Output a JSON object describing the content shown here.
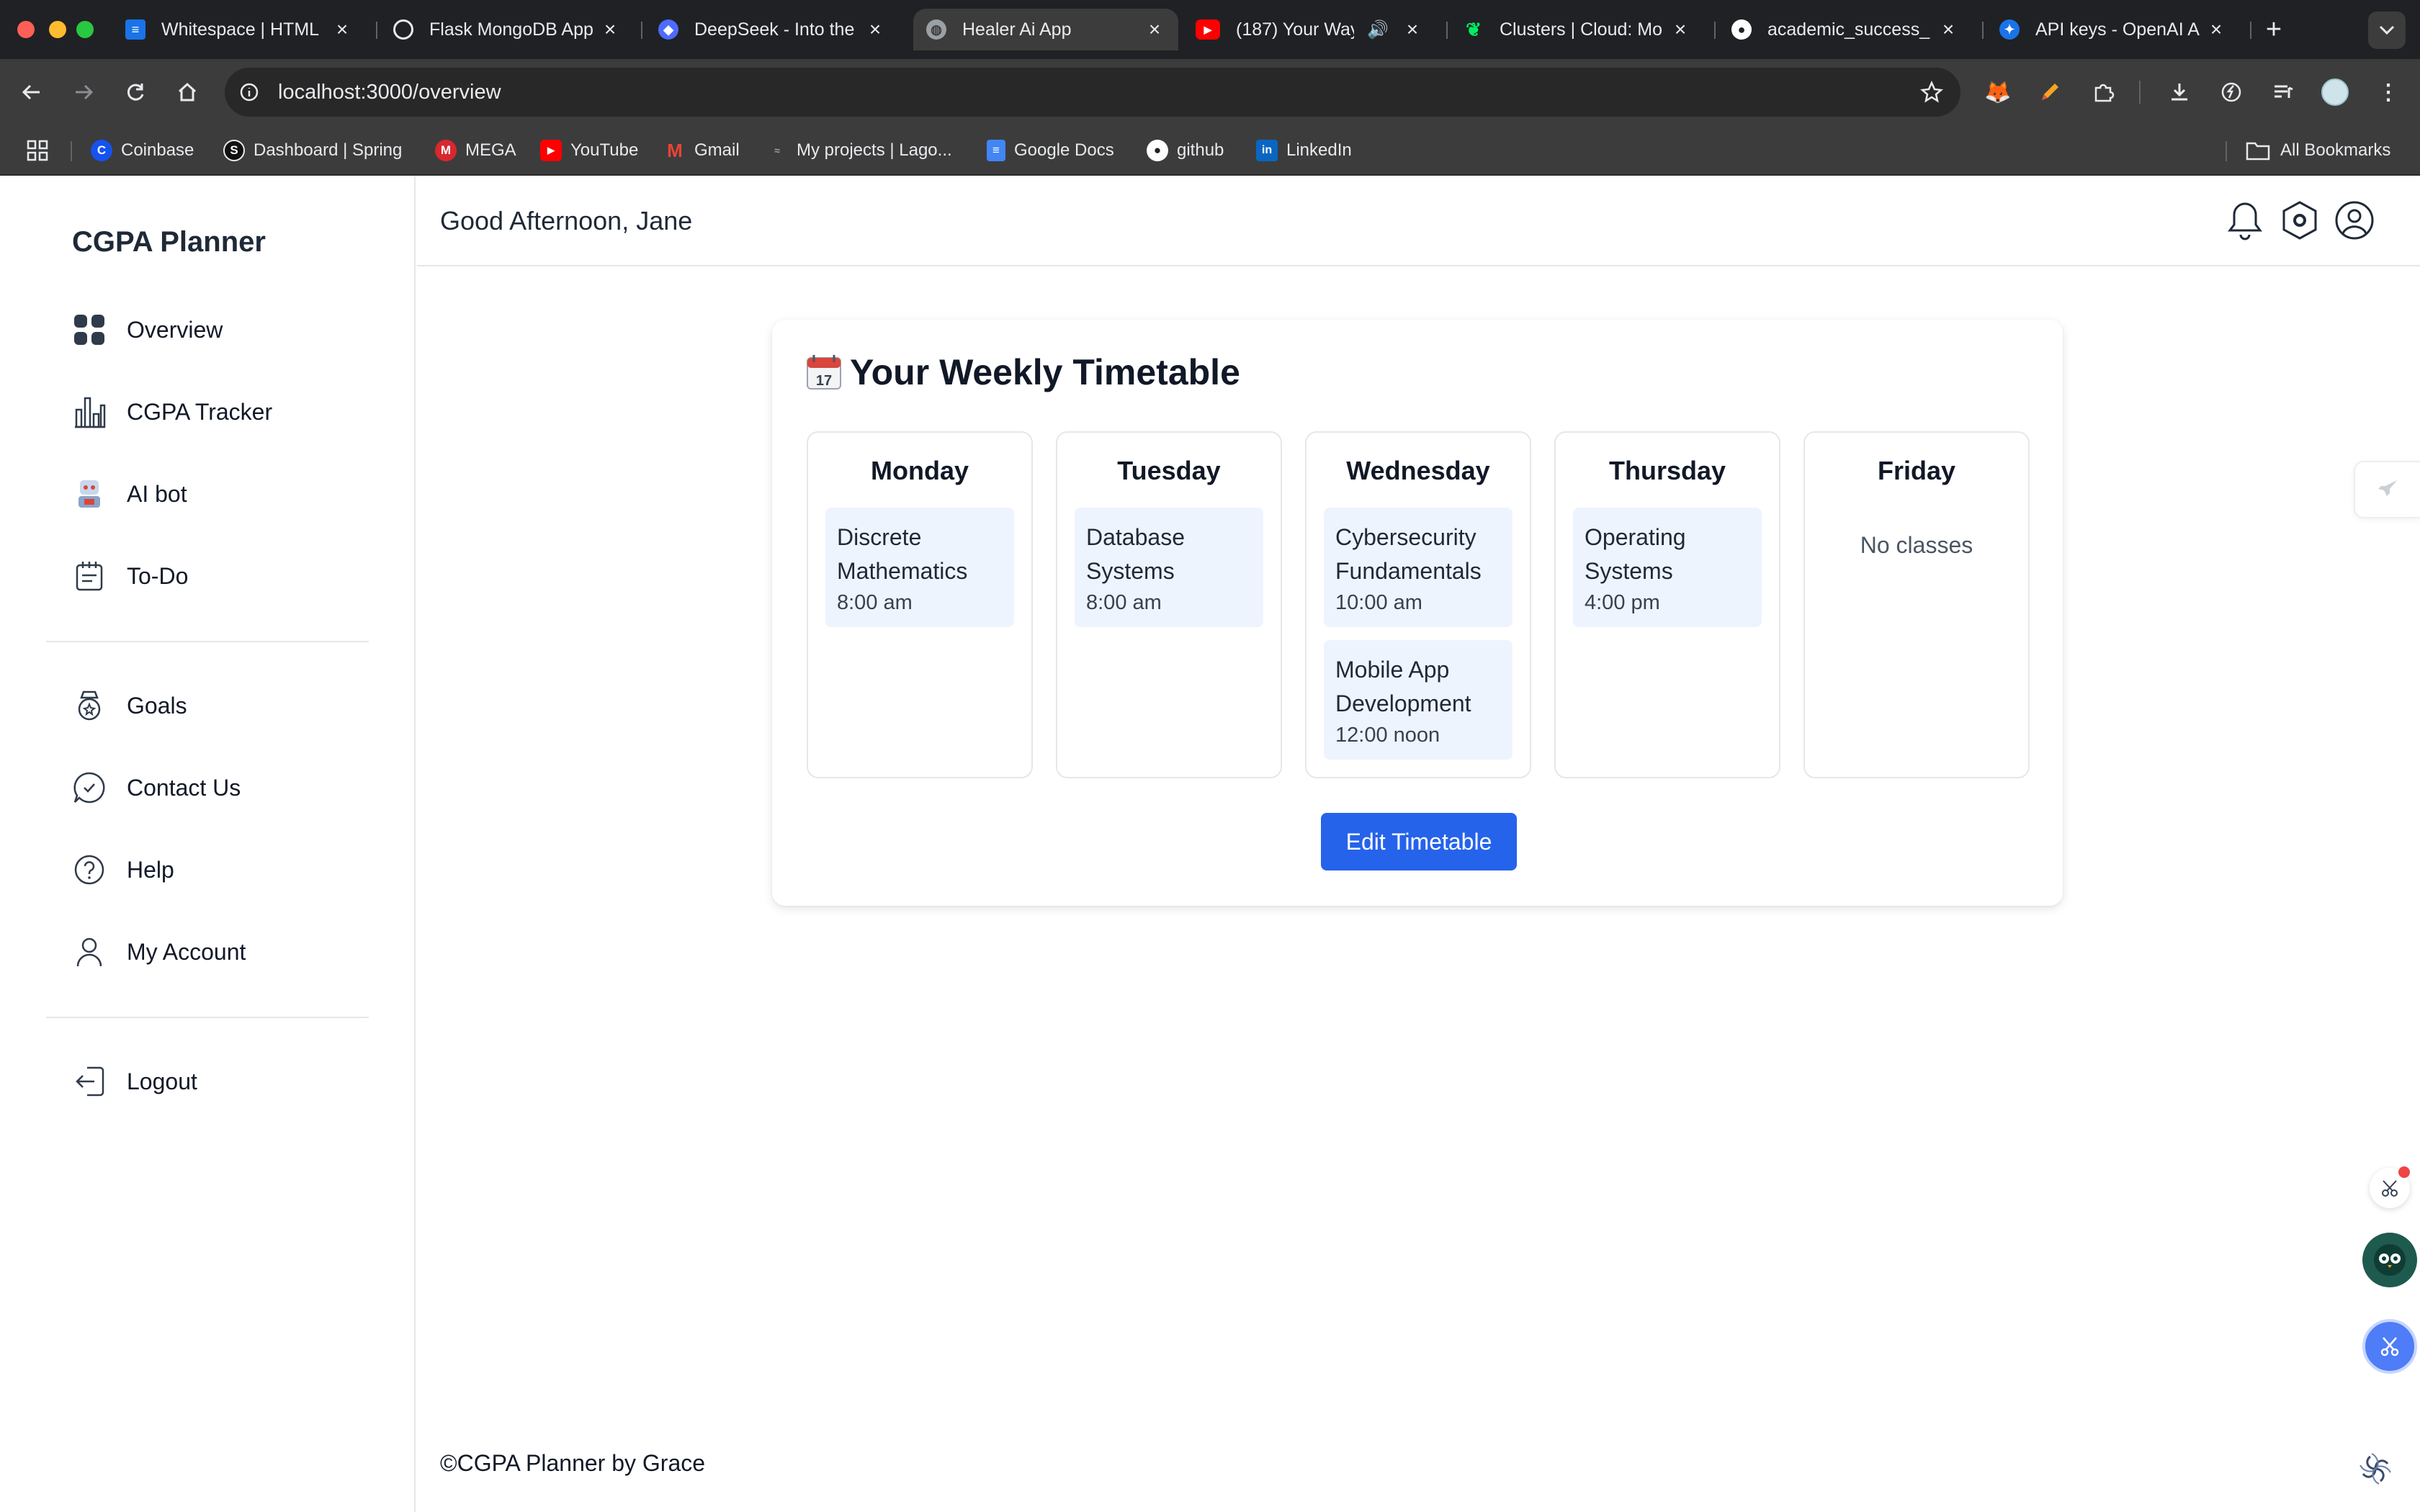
{
  "browser": {
    "tabs": [
      {
        "title": "Whitespace | HTML",
        "icon": "document-icon",
        "color": "#1a73e8"
      },
      {
        "title": "Flask MongoDB App",
        "icon": "openai-icon",
        "color": "#e8eaed"
      },
      {
        "title": "DeepSeek - Into the",
        "icon": "deepseek-icon",
        "color": "#4d6bfe"
      },
      {
        "title": "Healer Ai App",
        "icon": "globe-icon",
        "color": "#9aa0a6"
      },
      {
        "title": "(187) Your Way",
        "icon": "youtube-icon",
        "color": "#ff0000"
      },
      {
        "title": "Clusters | Cloud: Mo",
        "icon": "mongodb-leaf-icon",
        "color": "#00ed64"
      },
      {
        "title": "academic_success_",
        "icon": "github-icon",
        "color": "#ffffff"
      },
      {
        "title": "API keys - OpenAI A",
        "icon": "openai-icon",
        "color": "#1a73e8"
      }
    ],
    "active_tab_index": 3,
    "url": "localhost:3000/overview",
    "bookmarks": [
      {
        "label": "Coinbase",
        "icon": "coinbase-icon",
        "color": "#1652f0"
      },
      {
        "label": "Dashboard | Spring",
        "icon": "spring-icon",
        "color": "#111111"
      },
      {
        "label": "MEGA",
        "icon": "mega-icon",
        "color": "#d9272e"
      },
      {
        "label": "YouTube",
        "icon": "youtube-icon",
        "color": "#ff0000"
      },
      {
        "label": "Gmail",
        "icon": "gmail-icon",
        "color": "#ea4335"
      },
      {
        "label": "My projects | Lago...",
        "icon": "lago-icon",
        "color": "#5f6368"
      },
      {
        "label": "Google Docs",
        "icon": "google-docs-icon",
        "color": "#4285f4"
      },
      {
        "label": "github",
        "icon": "github-icon",
        "color": "#ffffff"
      },
      {
        "label": "LinkedIn",
        "icon": "linkedin-icon",
        "color": "#0a66c2"
      }
    ],
    "all_bookmarks_label": "All Bookmarks"
  },
  "sidebar": {
    "brand": "CGPA Planner",
    "items": [
      {
        "label": "Overview",
        "icon": "dashboard-grid-icon"
      },
      {
        "label": "CGPA Tracker",
        "icon": "bar-chart-icon"
      },
      {
        "label": "AI bot",
        "icon": "robot-icon"
      },
      {
        "label": "To-Do",
        "icon": "notepad-icon"
      }
    ],
    "secondary_items": [
      {
        "label": "Goals",
        "icon": "goal-badge-icon"
      },
      {
        "label": "Contact Us",
        "icon": "chat-bubble-icon"
      },
      {
        "label": "Help",
        "icon": "question-circle-icon"
      },
      {
        "label": "My Account",
        "icon": "user-icon"
      }
    ],
    "logout": {
      "label": "Logout",
      "icon": "logout-icon"
    }
  },
  "header": {
    "greeting": "Good Afternoon, Jane",
    "icons": [
      "bell-icon",
      "settings-hex-icon",
      "profile-circle-icon"
    ]
  },
  "timetable": {
    "emoji": "📅",
    "title": "Your Weekly Timetable",
    "days": [
      {
        "name": "Monday",
        "classes": [
          {
            "name": "Discrete Mathematics",
            "time": "8:00 am"
          }
        ]
      },
      {
        "name": "Tuesday",
        "classes": [
          {
            "name": "Database Systems",
            "time": "8:00 am"
          }
        ]
      },
      {
        "name": "Wednesday",
        "classes": [
          {
            "name": "Cybersecurity Fundamentals",
            "time": "10:00 am"
          },
          {
            "name": "Mobile App Development",
            "time": "12:00 noon"
          }
        ]
      },
      {
        "name": "Thursday",
        "classes": [
          {
            "name": "Operating Systems",
            "time": "4:00 pm"
          }
        ]
      },
      {
        "name": "Friday",
        "classes": [],
        "empty_text": "No classes"
      }
    ],
    "edit_button": "Edit Timetable"
  },
  "footer": {
    "text": "©CGPA Planner by Grace"
  },
  "colors": {
    "primary_button": "#2563eb",
    "class_bg": "#eef4fd",
    "border": "#e5e7eb"
  }
}
